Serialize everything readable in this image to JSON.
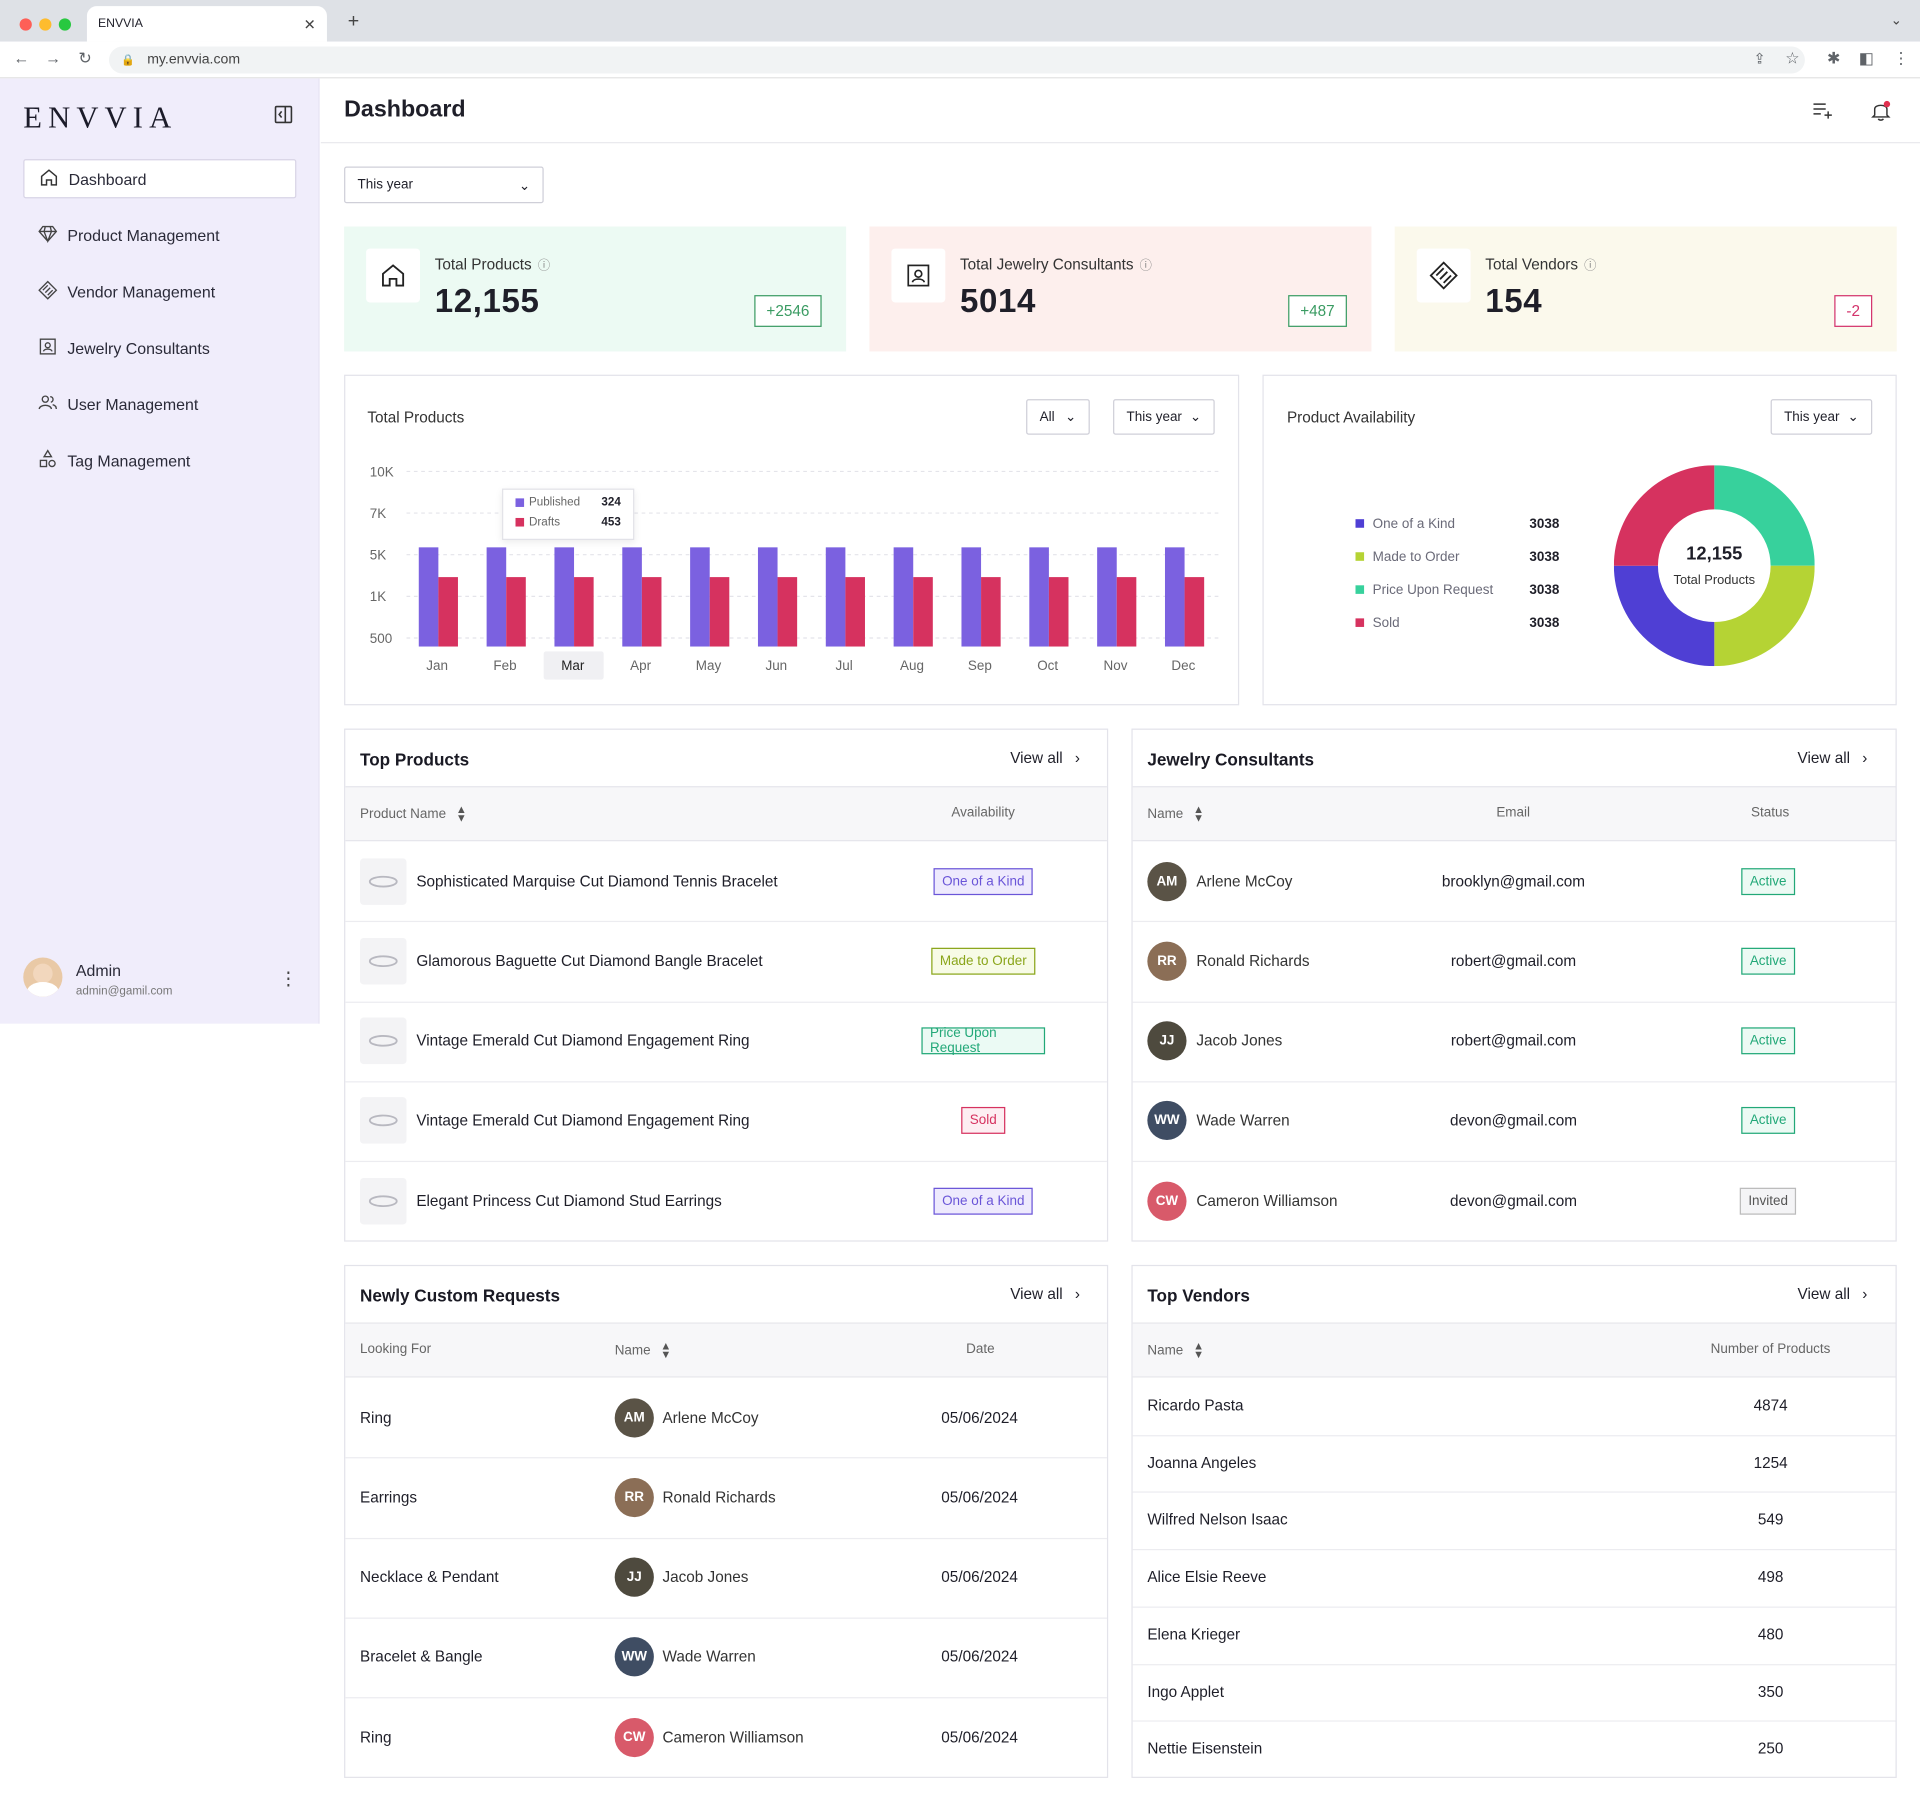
{
  "browser": {
    "tab_title": "ENVVIA",
    "url": "my.envvia.com"
  },
  "sidebar": {
    "logo": "ENVVIA",
    "items": [
      {
        "label": "Dashboard",
        "icon": "home-icon"
      },
      {
        "label": "Product Management",
        "icon": "diamond-icon"
      },
      {
        "label": "Vendor Management",
        "icon": "handshake-icon"
      },
      {
        "label": "Jewelry Consultants",
        "icon": "contact-icon"
      },
      {
        "label": "User Management",
        "icon": "users-icon"
      },
      {
        "label": "Tag Management",
        "icon": "shapes-icon"
      }
    ],
    "user": {
      "name": "Admin",
      "email": "admin@gamil.com"
    }
  },
  "header": {
    "title": "Dashboard"
  },
  "period_filter": "This year",
  "stats": [
    {
      "label": "Total Products",
      "value": "12,155",
      "delta": "+2546",
      "delta_color": "#3a9b62",
      "bg": "#ecfaf3",
      "icon": "home-icon"
    },
    {
      "label": "Total Jewelry Consultants",
      "value": "5014",
      "delta": "+487",
      "delta_color": "#3a9b62",
      "bg": "#fdefed",
      "icon": "contact-icon"
    },
    {
      "label": "Total Vendors",
      "value": "154",
      "delta": "-2",
      "delta_color": "#d3336b",
      "bg": "#fbf9ec",
      "icon": "handshake-icon"
    }
  ],
  "total_products_chart": {
    "title": "Total Products",
    "filter_all": "All",
    "filter_period": "This year",
    "tooltip": {
      "published_label": "Published",
      "published_value": "324",
      "drafts_label": "Drafts",
      "drafts_value": "453"
    },
    "highlighted_month": "Mar"
  },
  "chart_data": {
    "type": "bar",
    "categories": [
      "Jan",
      "Feb",
      "Mar",
      "Apr",
      "May",
      "Jun",
      "Jul",
      "Aug",
      "Sep",
      "Oct",
      "Nov",
      "Dec"
    ],
    "y_ticks": [
      "10K",
      "7K",
      "5K",
      "1K",
      "500"
    ],
    "series": [
      {
        "name": "Published",
        "color": "#7b61e0",
        "values": [
          5000,
          5000,
          5000,
          5000,
          5000,
          5000,
          5000,
          5000,
          5000,
          5000,
          5000,
          5000
        ]
      },
      {
        "name": "Drafts",
        "color": "#d6325f",
        "values": [
          3500,
          3500,
          3500,
          3500,
          3500,
          3500,
          3500,
          3500,
          3500,
          3500,
          3500,
          3500
        ]
      }
    ],
    "ylim": [
      0,
      10000
    ]
  },
  "availability": {
    "title": "Product Availability",
    "filter_period": "This year",
    "center_value": "12,155",
    "center_label": "Total Products",
    "legend": [
      {
        "label": "One of a Kind",
        "value": "3038",
        "color": "#4f3fd4"
      },
      {
        "label": "Made to Order",
        "value": "3038",
        "color": "#b5d334"
      },
      {
        "label": "Price Upon Request",
        "value": "3038",
        "color": "#37d19c"
      },
      {
        "label": "Sold",
        "value": "3038",
        "color": "#d6325f"
      }
    ]
  },
  "top_products": {
    "title": "Top Products",
    "view_all": "View all",
    "col_name": "Product Name",
    "col_availability": "Availability",
    "rows": [
      {
        "name": "Sophisticated Marquise Cut Diamond Tennis Bracelet",
        "availability": "One of a Kind",
        "badge_color": "#6a55d8",
        "badge_bg": "#eeeafd"
      },
      {
        "name": "Glamorous Baguette Cut Diamond Bangle Bracelet",
        "availability": "Made to Order",
        "badge_color": "#8aa51a",
        "badge_bg": "#f7fbe6"
      },
      {
        "name": "Vintage Emerald Cut Diamond Engagement Ring",
        "availability": "Price Upon Request",
        "badge_color": "#22a878",
        "badge_bg": "#ebfaf4"
      },
      {
        "name": "Vintage Emerald Cut Diamond Engagement Ring",
        "availability": "Sold",
        "badge_color": "#d6325f",
        "badge_bg": "#fdeef2"
      },
      {
        "name": "Elegant Princess Cut Diamond Stud Earrings",
        "availability": "One of a Kind",
        "badge_color": "#6a55d8",
        "badge_bg": "#eeeafd"
      }
    ]
  },
  "consultants": {
    "title": "Jewelry Consultants",
    "view_all": "View all",
    "col_name": "Name",
    "col_email": "Email",
    "col_status": "Status",
    "rows": [
      {
        "name": "Arlene McCoy",
        "email": "brooklyn@gmail.com",
        "status": "Active",
        "initials": "AM",
        "avatar_bg": "#5a5346"
      },
      {
        "name": "Ronald Richards",
        "email": "robert@gmail.com",
        "status": "Active",
        "initials": "RR",
        "avatar_bg": "#8b6e56"
      },
      {
        "name": "Jacob Jones",
        "email": "robert@gmail.com",
        "status": "Active",
        "initials": "JJ",
        "avatar_bg": "#4e4a3e"
      },
      {
        "name": "Wade Warren",
        "email": "devon@gmail.com",
        "status": "Active",
        "initials": "WW",
        "avatar_bg": "#3f4d63"
      },
      {
        "name": "Cameron Williamson",
        "email": "devon@gmail.com",
        "status": "Invited",
        "initials": "CW",
        "avatar_bg": "#d85a6a"
      }
    ]
  },
  "custom_requests": {
    "title": "Newly Custom Requests",
    "view_all": "View all",
    "col_looking": "Looking For",
    "col_name": "Name",
    "col_date": "Date",
    "rows": [
      {
        "looking": "Ring",
        "name": "Arlene McCoy",
        "date": "05/06/2024",
        "initials": "AM",
        "avatar_bg": "#5a5346"
      },
      {
        "looking": "Earrings",
        "name": "Ronald Richards",
        "date": "05/06/2024",
        "initials": "RR",
        "avatar_bg": "#8b6e56"
      },
      {
        "looking": "Necklace & Pendant",
        "name": "Jacob Jones",
        "date": "05/06/2024",
        "initials": "JJ",
        "avatar_bg": "#4e4a3e"
      },
      {
        "looking": "Bracelet & Bangle",
        "name": "Wade Warren",
        "date": "05/06/2024",
        "initials": "WW",
        "avatar_bg": "#3f4d63"
      },
      {
        "looking": "Ring",
        "name": "Cameron Williamson",
        "date": "05/06/2024",
        "initials": "CW",
        "avatar_bg": "#d85a6a"
      }
    ]
  },
  "top_vendors": {
    "title": "Top Vendors",
    "view_all": "View all",
    "col_name": "Name",
    "col_count": "Number of Products",
    "rows": [
      {
        "name": "Ricardo Pasta",
        "count": "4874"
      },
      {
        "name": "Joanna Angeles",
        "count": "1254"
      },
      {
        "name": "Wilfred Nelson Isaac",
        "count": "549"
      },
      {
        "name": "Alice Elsie Reeve",
        "count": "498"
      },
      {
        "name": "Elena Krieger",
        "count": "480"
      },
      {
        "name": "Ingo Applet",
        "count": "350"
      },
      {
        "name": "Nettie Eisenstein",
        "count": "250"
      }
    ]
  }
}
